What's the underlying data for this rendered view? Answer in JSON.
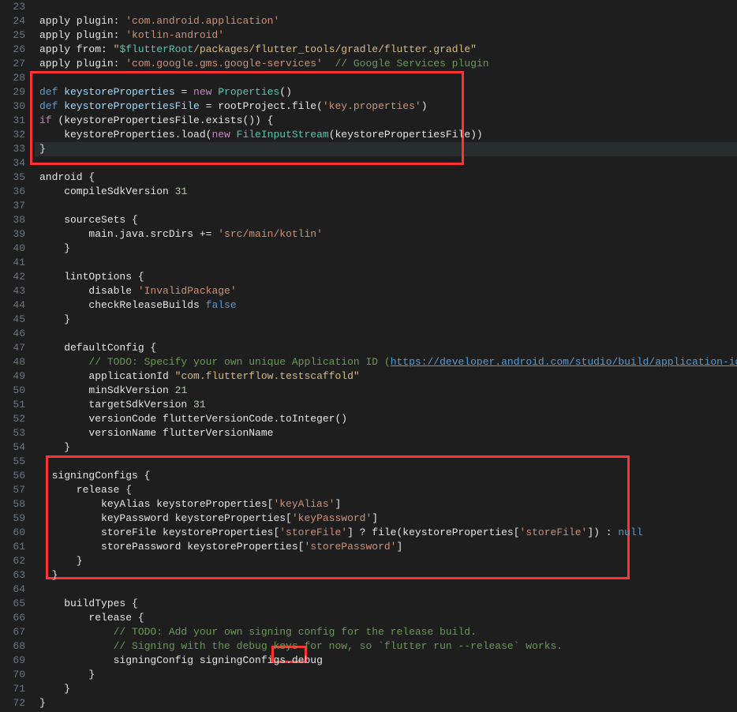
{
  "lines": {
    "ln23": "23",
    "ln24": "24",
    "ln25": "25",
    "ln26": "26",
    "ln27": "27",
    "ln28": "28",
    "ln29": "29",
    "ln30": "30",
    "ln31": "31",
    "ln32": "32",
    "ln33": "33",
    "ln34": "34",
    "ln35": "35",
    "ln36": "36",
    "ln37": "37",
    "ln38": "38",
    "ln39": "39",
    "ln40": "40",
    "ln41": "41",
    "ln42": "42",
    "ln43": "43",
    "ln44": "44",
    "ln45": "45",
    "ln46": "46",
    "ln47": "47",
    "ln48": "48",
    "ln49": "49",
    "ln50": "50",
    "ln51": "51",
    "ln52": "52",
    "ln53": "53",
    "ln54": "54",
    "ln55": "55",
    "ln56": "56",
    "ln57": "57",
    "ln58": "58",
    "ln59": "59",
    "ln60": "60",
    "ln61": "61",
    "ln62": "62",
    "ln63": "63",
    "ln64": "64",
    "ln65": "65",
    "ln66": "66",
    "ln67": "67",
    "ln68": "68",
    "ln69": "69",
    "ln70": "70",
    "ln71": "71",
    "ln72": "72"
  },
  "code": {
    "l24_apply": "apply plugin: ",
    "l24_str": "'com.android.application'",
    "l25_apply": "apply plugin: ",
    "l25_str": "'kotlin-android'",
    "l26_apply": "apply from: ",
    "l26_q1": "\"",
    "l26_var": "$flutterRoot",
    "l26_rest": "/packages/flutter_tools/gradle/flutter.gradle\"",
    "l27_apply": "apply plugin: ",
    "l27_str": "'com.google.gms.google-services'",
    "l27_com": "  // Google Services plugin",
    "l29_def": "def",
    "l29_var": " keystoreProperties",
    "l29_eq": " = ",
    "l29_new": "new",
    "l29_type": " Properties",
    "l29_paren": "()",
    "l30_def": "def",
    "l30_var": " keystorePropertiesFile",
    "l30_eq": " = rootProject.file(",
    "l30_str": "'key.properties'",
    "l30_close": ")",
    "l31_if": "if",
    "l31_cond": " (keystorePropertiesFile.exists()) {",
    "l32_indent": "    keystoreProperties.load(",
    "l32_new": "new",
    "l32_sp": " ",
    "l32_type": "FileInputStream",
    "l32_rest": "(keystorePropertiesFile))",
    "l33_brace": "}",
    "l35_android": "android {",
    "l36_compile": "    compileSdkVersion ",
    "l36_num": "31",
    "l38_source": "    sourceSets {",
    "l39_main": "        main.java.srcDirs += ",
    "l39_str": "'src/main/kotlin'",
    "l40_brace": "    }",
    "l42_lint": "    lintOptions {",
    "l43_disable": "        disable ",
    "l43_str": "'InvalidPackage'",
    "l44_check": "        checkReleaseBuilds ",
    "l44_false": "false",
    "l45_brace": "    }",
    "l47_default": "    defaultConfig {",
    "l48_com": "        // TODO: Specify your own unique Application ID (",
    "l48_link": "https://developer.android.com/studio/build/application-id.html",
    "l48_close": ").",
    "l49_appid": "        applicationId ",
    "l49_str": "\"com.flutterflow.testscaffold\"",
    "l50_min": "        minSdkVersion ",
    "l50_num": "21",
    "l51_target": "        targetSdkVersion ",
    "l51_num": "31",
    "l52_vcode": "        versionCode flutterVersionCode.toInteger()",
    "l53_vname": "        versionName flutterVersionName",
    "l54_brace": "    }",
    "l56_signing": "  signingConfigs {",
    "l57_release": "      release {",
    "l58_keyalias": "          keyAlias keystoreProperties[",
    "l58_str": "'keyAlias'",
    "l58_close": "]",
    "l59_keypass": "          keyPassword keystoreProperties[",
    "l59_str": "'keyPassword'",
    "l59_close": "]",
    "l60_storefile": "          storeFile keystoreProperties[",
    "l60_str1": "'storeFile'",
    "l60_mid": "] ? file(keystoreProperties[",
    "l60_str2": "'storeFile'",
    "l60_close": "]) : ",
    "l60_null": "null",
    "l61_storepass": "          storePassword keystoreProperties[",
    "l61_str": "'storePassword'",
    "l61_close": "]",
    "l62_brace": "      }",
    "l63_brace": "  }",
    "l65_build": "    buildTypes {",
    "l66_release": "        release {",
    "l67_com": "            // TODO: Add your own signing config for the release build.",
    "l68_com": "            // Signing with the debug keys for now, so `flutter run --release` works.",
    "l69_sign": "            signingConfig signingConfigs.",
    "l69_debug": "debug",
    "l70_brace": "        }",
    "l71_brace": "    }",
    "l72_brace": "}"
  }
}
